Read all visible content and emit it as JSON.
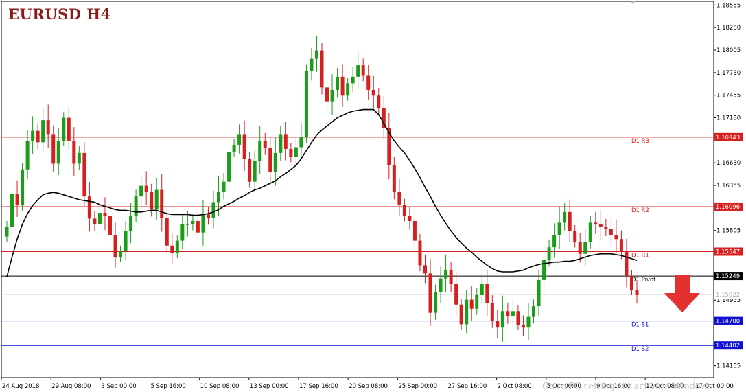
{
  "title": "EURUSD  H4",
  "watermark": "Go to PC settings to activate Windows",
  "colors": {
    "bull": "#1a9e1a",
    "bear": "#d62020",
    "ma": "#000000",
    "resistance": "#d62020",
    "pivot": "#000000",
    "support": "#1010d0",
    "current": "#c0c0c0",
    "arrow": "#e53030"
  },
  "chart_data": {
    "type": "candlestick",
    "symbol": "EURUSD",
    "timeframe": "H4",
    "ylim": [
      1.1401,
      1.186
    ],
    "y_ticks": [
      "1.18555",
      "1.18280",
      "1.18005",
      "1.17730",
      "1.17455",
      "1.17180",
      "1.16630",
      "1.16355",
      "1.15805",
      "1.14955",
      "1.14155"
    ],
    "x_ticks": [
      "24 Aug 2018",
      "29 Aug 08:00",
      "3 Sep 00:00",
      "5 Sep 16:00",
      "10 Sep 08:00",
      "13 Sep 00:00",
      "17 Sep 16:00",
      "20 Sep 08:00",
      "25 Sep 00:00",
      "27 Sep 16:00",
      "2 Oct 08:00",
      "5 Oct 00:00",
      "9 Oct 16:00",
      "12 Oct 08:00",
      "17 Oct 00:00"
    ],
    "levels": [
      {
        "label": "D1 R3",
        "value": 1.16943,
        "value_label": "1.16943",
        "kind": "resistance"
      },
      {
        "label": "D1 R2",
        "value": 1.16096,
        "value_label": "1.16096",
        "kind": "resistance"
      },
      {
        "label": "D1 R1",
        "value": 1.15547,
        "value_label": "1.15547",
        "kind": "resistance"
      },
      {
        "label": "D1 Pivot",
        "value": 1.15249,
        "value_label": "1.15249",
        "kind": "pivot"
      },
      {
        "label": "D1 S1",
        "value": 1.147,
        "value_label": "1.14700",
        "kind": "support"
      },
      {
        "label": "D1 S2",
        "value": 1.14402,
        "value_label": "1.14402",
        "kind": "support"
      }
    ],
    "current_price": 1.15022,
    "current_price_label": "1.15022",
    "closes": [
      1.1585,
      1.1625,
      1.1612,
      1.1655,
      1.169,
      1.1702,
      1.1688,
      1.1715,
      1.1698,
      1.1662,
      1.169,
      1.1718,
      1.169,
      1.1662,
      1.1675,
      1.1622,
      1.1595,
      1.1588,
      1.1602,
      1.1598,
      1.1575,
      1.1548,
      1.1555,
      1.158,
      1.1598,
      1.1622,
      1.1635,
      1.1628,
      1.1606,
      1.163,
      1.1596,
      1.1562,
      1.1553,
      1.1568,
      1.1588,
      1.1588,
      1.1592,
      1.1578,
      1.16,
      1.1596,
      1.1615,
      1.1628,
      1.164,
      1.1676,
      1.1685,
      1.1698,
      1.1668,
      1.164,
      1.1665,
      1.169,
      1.1681,
      1.1652,
      1.1675,
      1.1698,
      1.168,
      1.167,
      1.1682,
      1.1695,
      1.1775,
      1.179,
      1.18,
      1.1755,
      1.1738,
      1.1752,
      1.1768,
      1.1745,
      1.176,
      1.1768,
      1.1782,
      1.177,
      1.1752,
      1.1745,
      1.173,
      1.1705,
      1.166,
      1.1628,
      1.1612,
      1.1598,
      1.1592,
      1.1568,
      1.1538,
      1.1528,
      1.148,
      1.1505,
      1.1522,
      1.1532,
      1.1515,
      1.149,
      1.1466,
      1.1496,
      1.1485,
      1.1502,
      1.1515,
      1.1492,
      1.147,
      1.1462,
      1.1482,
      1.1476,
      1.1482,
      1.1465,
      1.1462,
      1.1475,
      1.1488,
      1.152,
      1.1545,
      1.156,
      1.1575,
      1.159,
      1.1603,
      1.158,
      1.1566,
      1.1552,
      1.1566,
      1.159,
      1.1588,
      1.1585,
      1.1582,
      1.1575,
      1.157,
      1.1555,
      1.1525,
      1.1508,
      1.1502
    ],
    "moving_average": [
      1.1524,
      1.1548,
      1.157,
      1.1588,
      1.1601,
      1.1611,
      1.1618,
      1.1624,
      1.1626,
      1.1627,
      1.1626,
      1.1624,
      1.1622,
      1.162,
      1.1618,
      1.1617,
      1.1616,
      1.1615,
      1.1612,
      1.161,
      1.1608,
      1.1606,
      1.1605,
      1.1605,
      1.1604,
      1.1603,
      1.1603,
      1.1604,
      1.1605,
      1.1605,
      1.1603,
      1.1601,
      1.16,
      1.16,
      1.16,
      1.16,
      1.1599,
      1.1599,
      1.16,
      1.1601,
      1.1603,
      1.1606,
      1.161,
      1.1613,
      1.1616,
      1.162,
      1.1623,
      1.1627,
      1.163,
      1.1632,
      1.1635,
      1.1638,
      1.1641,
      1.1646,
      1.165,
      1.1655,
      1.166,
      1.1668,
      1.1678,
      1.1688,
      1.1697,
      1.1703,
      1.1708,
      1.1713,
      1.1718,
      1.1721,
      1.1724,
      1.1726,
      1.1727,
      1.1728,
      1.1728,
      1.1728,
      1.1722,
      1.1711,
      1.17,
      1.169,
      1.1682,
      1.1675,
      1.1666,
      1.1656,
      1.1645,
      1.1633,
      1.1622,
      1.161,
      1.1599,
      1.1589,
      1.158,
      1.1572,
      1.1565,
      1.1559,
      1.1554,
      1.1548,
      1.1543,
      1.1538,
      1.1534,
      1.1531,
      1.153,
      1.153,
      1.153,
      1.1531,
      1.1532,
      1.1535,
      1.1537,
      1.1539,
      1.154,
      1.1541,
      1.1542,
      1.1542,
      1.1543,
      1.1543,
      1.1544,
      1.1546,
      1.1548,
      1.155,
      1.1551,
      1.1552,
      1.1552,
      1.1552,
      1.1551,
      1.155,
      1.1548,
      1.1546,
      1.1544
    ]
  }
}
